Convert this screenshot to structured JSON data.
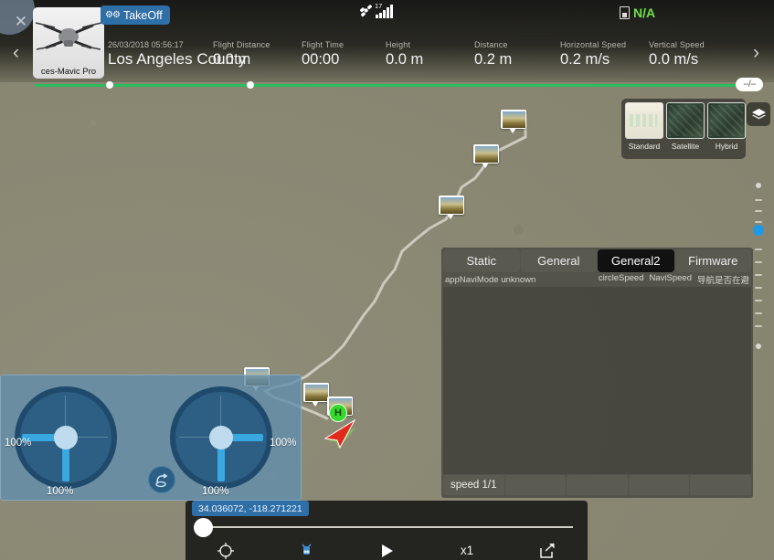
{
  "header": {
    "close_icon": "close-icon",
    "drone_name": "ces-Mavic Pro",
    "takeoff_label": "TakeOff",
    "takeoff_icon": "drone-icon",
    "prev_icon": "‹",
    "next_icon": "›",
    "datetime": "26/03/2018 05:56:17",
    "location": "Los Angeles County",
    "satellite_icon": "satellite-icon",
    "satellite_count": "17",
    "signal_icon": "signal-bars-icon",
    "battery_icon": "battery-icon",
    "battery_value": "N/A",
    "stats": [
      {
        "key": "Flight Distance",
        "value": "0.0 m"
      },
      {
        "key": "Flight Time",
        "value": "00:00"
      },
      {
        "key": "Height",
        "value": "0.0 m"
      },
      {
        "key": "Distance",
        "value": "0.2 m"
      },
      {
        "key": "Horizontal Speed",
        "value": "0.2 m/s"
      },
      {
        "key": "Vertical Speed",
        "value": "0.0 m/s"
      }
    ],
    "progress_badge": "--/--",
    "progress_color": "#2bbd5e"
  },
  "map": {
    "layer_icon": "layers-icon",
    "types": [
      {
        "name": "Standard",
        "selected": true
      },
      {
        "name": "Satellite",
        "selected": false
      },
      {
        "name": "Hybrid",
        "selected": false
      }
    ],
    "home_marker_label": "H",
    "home_marker_color": "#35d82b",
    "drone_marker_color": "#e02a1c",
    "photo_marker_icon": "photo-thumbnail-icon"
  },
  "controller": {
    "left_stick": {
      "horizontal_pct": "100%",
      "vertical_pct": "100%"
    },
    "right_stick": {
      "horizontal_pct": "100%",
      "vertical_pct": "100%"
    },
    "return_icon": "return-to-home-icon"
  },
  "param_panel": {
    "tabs": [
      {
        "label": "Static",
        "active": false
      },
      {
        "label": "General",
        "active": false
      },
      {
        "label": "General2",
        "active": true
      },
      {
        "label": "Firmware",
        "active": false
      }
    ],
    "sub_left": "appNaviMode unknown",
    "sub_right": [
      "circleSpeed",
      "NaviSpeed",
      "导航是否在避"
    ],
    "footer_label": "speed 1/1"
  },
  "playback": {
    "coordinates": "34.036072, -118.271221",
    "buttons": [
      {
        "name": "locate-icon",
        "label": ""
      },
      {
        "name": "drone-icon",
        "label": ""
      },
      {
        "name": "play-icon",
        "label": ""
      },
      {
        "name": "speed-label",
        "label": "x1"
      },
      {
        "name": "share-icon",
        "label": ""
      }
    ]
  }
}
